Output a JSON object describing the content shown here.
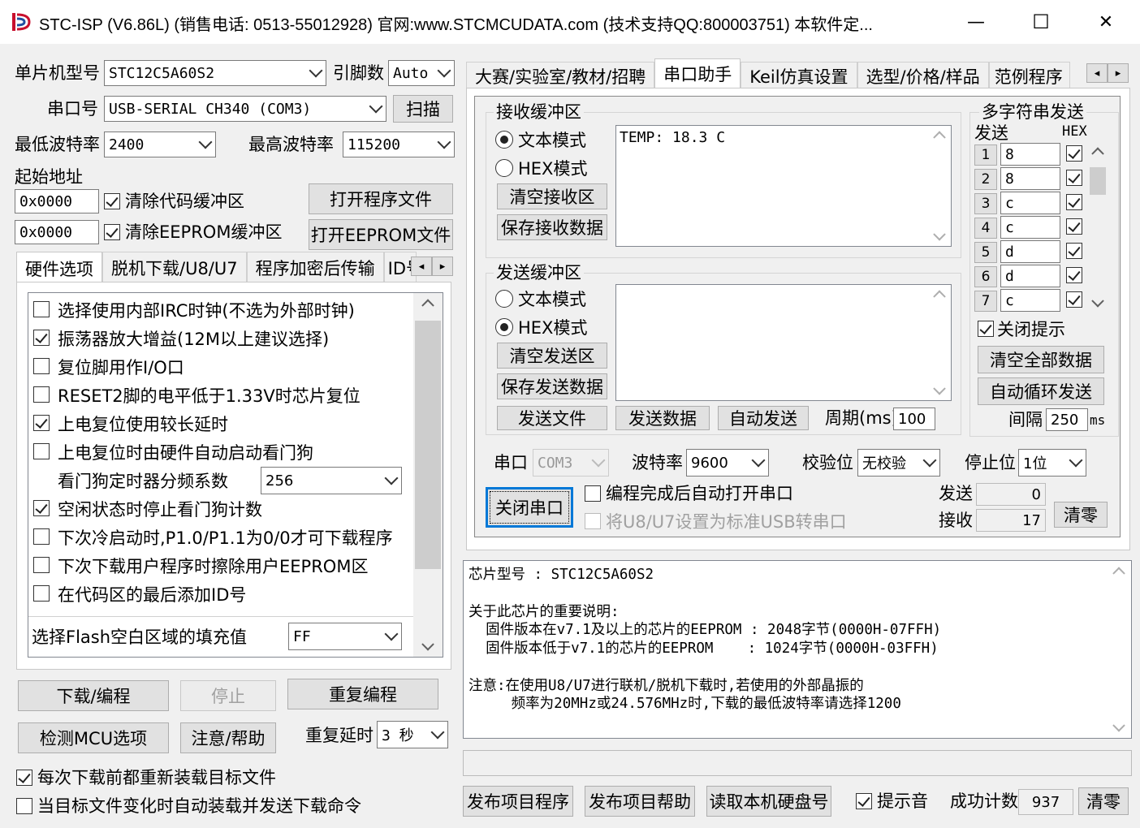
{
  "window": {
    "title": "STC-ISP (V6.86L) (销售电话: 0513-55012928) 官网:www.STCMCUDATA.com  (技术支持QQ:800003751) 本软件定...",
    "minimize": "—",
    "maximize": "☐",
    "close": "✕"
  },
  "left": {
    "mcu_label": "单片机型号",
    "mcu_value": "STC12C5A60S2",
    "pin_label": "引脚数",
    "pin_value": "Auto",
    "port_label": "串口号",
    "port_value": "USB-SERIAL CH340 (COM3)",
    "scan_button": "扫描",
    "min_baud_label": "最低波特率",
    "min_baud_value": "2400",
    "max_baud_label": "最高波特率",
    "max_baud_value": "115200",
    "start_addr_label": "起始地址",
    "addr1_value": "0x0000",
    "clear_code_label": "清除代码缓冲区",
    "open_prog_button": "打开程序文件",
    "addr2_value": "0x0000",
    "clear_eeprom_label": "清除EEPROM缓冲区",
    "open_eeprom_button": "打开EEPROM文件",
    "tabs": [
      "硬件选项",
      "脱机下载/U8/U7",
      "程序加密后传输",
      "ID号"
    ],
    "options": [
      {
        "label": "选择使用内部IRC时钟(不选为外部时钟)",
        "checked": false
      },
      {
        "label": "振荡器放大增益(12M以上建议选择)",
        "checked": true
      },
      {
        "label": "复位脚用作I/O口",
        "checked": false
      },
      {
        "label": "RESET2脚的电平低于1.33V时芯片复位",
        "checked": false
      },
      {
        "label": "上电复位使用较长延时",
        "checked": true
      },
      {
        "label": "上电复位时由硬件自动启动看门狗",
        "checked": false
      }
    ],
    "wdt_label": "看门狗定时器分频系数",
    "wdt_value": "256",
    "options2": [
      {
        "label": "空闲状态时停止看门狗计数",
        "checked": true
      },
      {
        "label": "下次冷启动时,P1.0/P1.1为0/0才可下载程序",
        "checked": false
      },
      {
        "label": "下次下载用户程序时擦除用户EEPROM区",
        "checked": false
      },
      {
        "label": "在代码区的最后添加ID号",
        "checked": false
      }
    ],
    "fill_label": "选择Flash空白区域的填充值",
    "fill_value": "FF",
    "download_button": "下载/编程",
    "stop_button": "停止",
    "reprogram_button": "重复编程",
    "check_mcu_button": "检测MCU选项",
    "help_button": "注意/帮助",
    "repeat_delay_label": "重复延时",
    "repeat_delay_value": "3 秒",
    "reload_label": "每次下载前都重新装载目标文件",
    "reload_checked": true,
    "auto_load_label": "当目标文件变化时自动装载并发送下载命令",
    "auto_load_checked": false
  },
  "right": {
    "tabs": [
      "大赛/实验室/教材/招聘",
      "串口助手",
      "Keil仿真设置",
      "选型/价格/样品",
      "范例程序"
    ],
    "recv_group": "接收缓冲区",
    "recv_text_mode": "文本模式",
    "recv_hex_mode": "HEX模式",
    "recv_clear": "清空接收区",
    "recv_save": "保存接收数据",
    "recv_content": "TEMP: 18.3 C",
    "send_group": "发送缓冲区",
    "send_text_mode": "文本模式",
    "send_hex_mode": "HEX模式",
    "send_clear": "清空发送区",
    "send_save": "保存发送数据",
    "send_content": "",
    "send_file": "发送文件",
    "send_data": "发送数据",
    "auto_send": "自动发送",
    "period_label": "周期(ms)",
    "period_value": "100",
    "multi_group": "多字符串发送",
    "multi_send_header": "发送",
    "multi_hex_header": "HEX",
    "multi_rows": [
      {
        "n": "1",
        "v": "8",
        "hex": true
      },
      {
        "n": "2",
        "v": "8",
        "hex": true
      },
      {
        "n": "3",
        "v": "c",
        "hex": true
      },
      {
        "n": "4",
        "v": "c",
        "hex": true
      },
      {
        "n": "5",
        "v": "d",
        "hex": true
      },
      {
        "n": "6",
        "v": "d",
        "hex": true
      },
      {
        "n": "7",
        "v": "c",
        "hex": true
      }
    ],
    "close_hint_label": "关闭提示",
    "clear_all_button": "清空全部数据",
    "loop_send_button": "自动循环发送",
    "interval_label": "间隔",
    "interval_value": "250",
    "interval_unit": "ms",
    "serial_label": "串口",
    "serial_value": "COM3",
    "baud_label": "波特率",
    "baud_value": "9600",
    "parity_label": "校验位",
    "parity_value": "无校验",
    "stop_label": "停止位",
    "stop_value": "1位",
    "close_port_button": "关闭串口",
    "auto_open_label": "编程完成后自动打开串口",
    "usb_label": "将U8/U7设置为标准USB转串口",
    "sent_label": "发送",
    "sent_value": "0",
    "recv_label": "接收",
    "recv_value": "17",
    "clear_count_button": "清零",
    "info_text": "芯片型号 : STC12C5A60S2\n\n关于此芯片的重要说明:\n  固件版本在v7.1及以上的芯片的EEPROM : 2048字节(0000H-07FFH)\n  固件版本低于v7.1的芯片的EEPROM    : 1024字节(0000H-03FFH)\n\n注意:在使用U8/U7进行联机/脱机下载时,若使用的外部晶振的\n     频率为20MHz或24.576MHz时,下载的最低波特率请选择1200",
    "publish_prog_button": "发布项目程序",
    "publish_help_button": "发布项目帮助",
    "read_disk_button": "读取本机硬盘号",
    "beep_label": "提示音",
    "beep_checked": true,
    "success_label": "成功计数",
    "success_value": "937",
    "clear_success_button": "清零"
  }
}
